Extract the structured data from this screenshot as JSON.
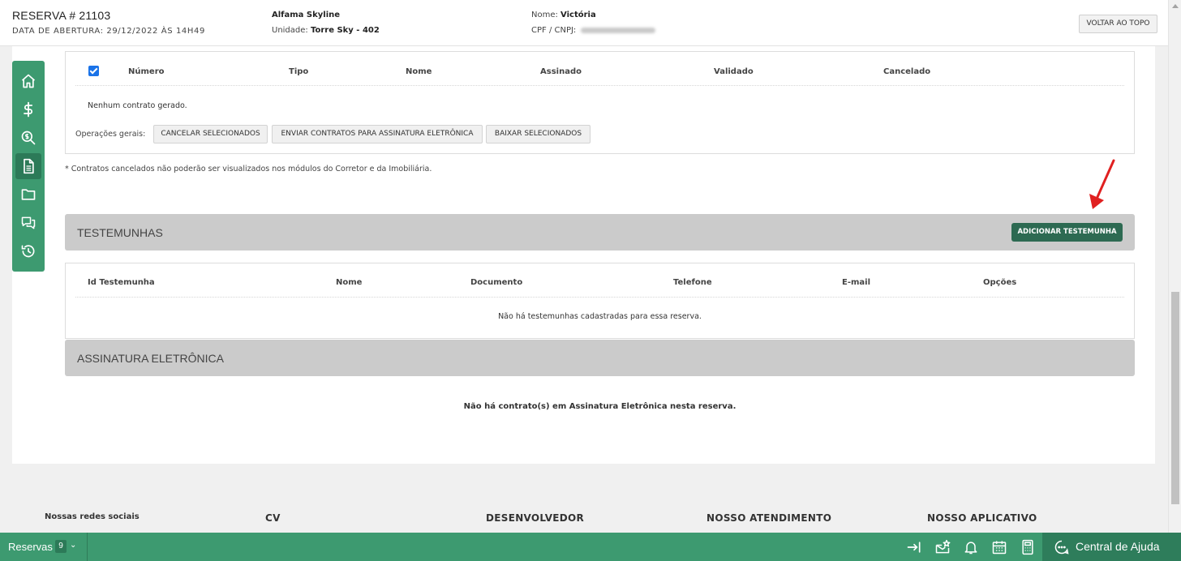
{
  "header": {
    "reservation_title": "RESERVA # 21103",
    "opening_date": "DATA DE ABERTURA: 29/12/2022 ÀS 14H49",
    "enterprise": "Alfama Skyline",
    "unit_label": "Unidade: ",
    "unit_value": "Torre Sky - 402",
    "client_name_label": "Nome: ",
    "client_name_value": "Victória",
    "client_doc_label": "CPF / CNPJ: ",
    "back_to_top_label": "VOLTAR AO TOPO"
  },
  "sidenav": {
    "items": [
      {
        "icon": "home-icon"
      },
      {
        "icon": "dollar-icon"
      },
      {
        "icon": "search-dollar-icon"
      },
      {
        "icon": "document-icon",
        "active": true
      },
      {
        "icon": "folder-icon"
      },
      {
        "icon": "chat-icon"
      },
      {
        "icon": "history-icon"
      }
    ]
  },
  "contracts": {
    "columns": [
      "Número",
      "Tipo",
      "Nome",
      "Assinado",
      "Validado",
      "Cancelado"
    ],
    "empty_message": "Nenhum contrato gerado.",
    "operations_label": "Operações gerais:",
    "operations": [
      "CANCELAR SELECIONADOS",
      "ENVIAR CONTRATOS PARA ASSINATURA ELETRÔNICA",
      "BAIXAR SELECIONADOS"
    ],
    "note": "* Contratos cancelados não poderão ser visualizados nos módulos do Corretor e da Imobiliária."
  },
  "witnesses": {
    "title": "TESTEMUNHAS",
    "add_button": "ADICIONAR TESTEMUNHA",
    "columns": [
      "Id Testemunha",
      "Nome",
      "Documento",
      "Telefone",
      "E-mail",
      "Opções"
    ],
    "empty_message": "Não há testemunhas cadastradas para essa reserva."
  },
  "electronic_signature": {
    "title": "ASSINATURA ELETRÔNICA",
    "empty_message": "Não há contrato(s) em Assinatura Eletrônica nesta reserva."
  },
  "footer": {
    "social_title": "Nossas redes sociais",
    "columns": [
      "CV",
      "DESENVOLVEDOR",
      "NOSSO ATENDIMENTO",
      "NOSSO APLICATIVO"
    ]
  },
  "bottombar": {
    "reservas_label": "Reservas",
    "reservas_count": "9",
    "help_label": "Central de Ajuda"
  },
  "colors": {
    "brand_green": "#3d9a70",
    "dark_green": "#2d6a52",
    "annotation_red": "#e02020"
  }
}
